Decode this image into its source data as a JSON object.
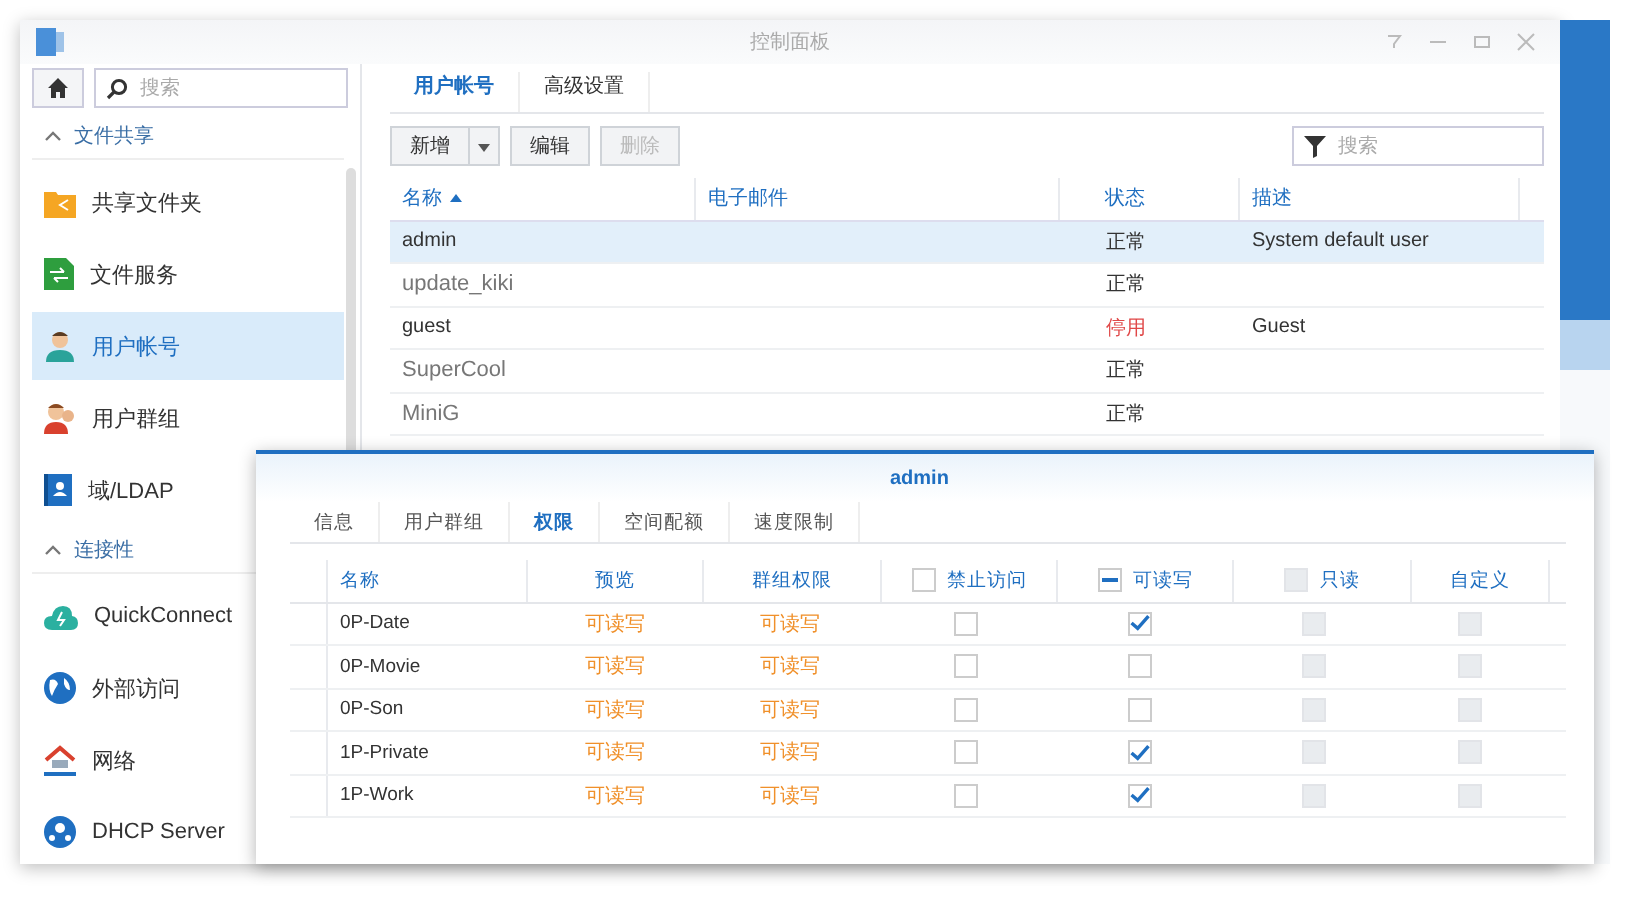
{
  "window": {
    "title": "控制面板"
  },
  "sidebar": {
    "search": {
      "placeholder": "搜索"
    },
    "items": [
      {
        "kind": "section",
        "label": "文件共享",
        "expanded": true
      },
      {
        "kind": "item",
        "label": "共享文件夹",
        "selected": false
      },
      {
        "kind": "item",
        "label": "文件服务",
        "selected": false
      },
      {
        "kind": "item",
        "label": "用户帐号",
        "selected": true
      },
      {
        "kind": "item",
        "label": "用户群组",
        "selected": false
      },
      {
        "kind": "item",
        "label": "域/LDAP",
        "selected": false
      },
      {
        "kind": "section",
        "label": "连接性",
        "expanded": true
      },
      {
        "kind": "item",
        "label": "QuickConnect",
        "selected": false
      },
      {
        "kind": "item",
        "label": "外部访问",
        "selected": false
      },
      {
        "kind": "item",
        "label": "网络",
        "selected": false
      },
      {
        "kind": "item",
        "label": "DHCP Server",
        "selected": false
      }
    ]
  },
  "tabs": [
    {
      "label": "用户帐号",
      "selected": true
    },
    {
      "label": "高级设置",
      "selected": false
    }
  ],
  "toolbar": {
    "buttons": [
      {
        "label": "新增",
        "kind": "split",
        "disabled": false
      },
      {
        "label": "编辑",
        "kind": "plain",
        "disabled": false
      },
      {
        "label": "删除",
        "kind": "plain",
        "disabled": true
      }
    ],
    "filter": {
      "placeholder": "搜索"
    }
  },
  "users": {
    "columns": [
      {
        "label": "名称",
        "sorted": true
      },
      {
        "label": "电子邮件",
        "sorted": false
      },
      {
        "label": "状态",
        "sorted": false
      },
      {
        "label": "描述",
        "sorted": false
      }
    ],
    "rows": [
      {
        "name": "admin",
        "kind": "system",
        "status": "正常",
        "enabled": true,
        "description": "System default user",
        "selected": true
      },
      {
        "name": "update_kiki",
        "kind": "user",
        "status": "正常",
        "enabled": true,
        "selected": false
      },
      {
        "name": "guest",
        "kind": "system",
        "status": "停用",
        "enabled": false,
        "description": "Guest",
        "selected": false
      },
      {
        "name": "SuperCool",
        "kind": "user",
        "status": "正常",
        "enabled": true,
        "selected": false
      },
      {
        "name": "MiniG",
        "kind": "user",
        "status": "正常",
        "enabled": true,
        "selected": false
      }
    ]
  },
  "dialog": {
    "title": "admin",
    "tabs": [
      {
        "label": "信息",
        "selected": false
      },
      {
        "label": "用户群组",
        "selected": false
      },
      {
        "label": "权限",
        "selected": true
      },
      {
        "label": "空间配额",
        "selected": false
      },
      {
        "label": "速度限制",
        "selected": false
      }
    ],
    "columns": [
      {
        "label": "名称",
        "kind": "text"
      },
      {
        "label": "预览",
        "kind": "text"
      },
      {
        "label": "群组权限",
        "kind": "text"
      },
      {
        "label": "禁止访问",
        "kind": "check",
        "partial": false,
        "disabled": false
      },
      {
        "label": "可读写",
        "kind": "check",
        "partial": true,
        "disabled": false
      },
      {
        "label": "只读",
        "kind": "check",
        "partial": false,
        "disabled": true
      },
      {
        "label": "自定义",
        "kind": "plain",
        "disabled": true
      }
    ],
    "rows": [
      {
        "name": "0P-Date",
        "preview": "可读写",
        "group": "可读写",
        "deny": false,
        "read_write": true,
        "read_only": false,
        "custom": false
      },
      {
        "name": "0P-Movie",
        "preview": "可读写",
        "group": "可读写",
        "deny": false,
        "read_write": false,
        "read_only": false,
        "custom": false
      },
      {
        "name": "0P-Son",
        "preview": "可读写",
        "group": "可读写",
        "deny": false,
        "read_write": false,
        "read_only": false,
        "custom": false
      },
      {
        "name": "1P-Private",
        "preview": "可读写",
        "group": "可读写",
        "deny": false,
        "read_write": true,
        "read_only": false,
        "custom": false
      },
      {
        "name": "1P-Work",
        "preview": "可读写",
        "group": "可读写",
        "deny": false,
        "read_write": true,
        "read_only": false,
        "custom": false
      }
    ]
  }
}
